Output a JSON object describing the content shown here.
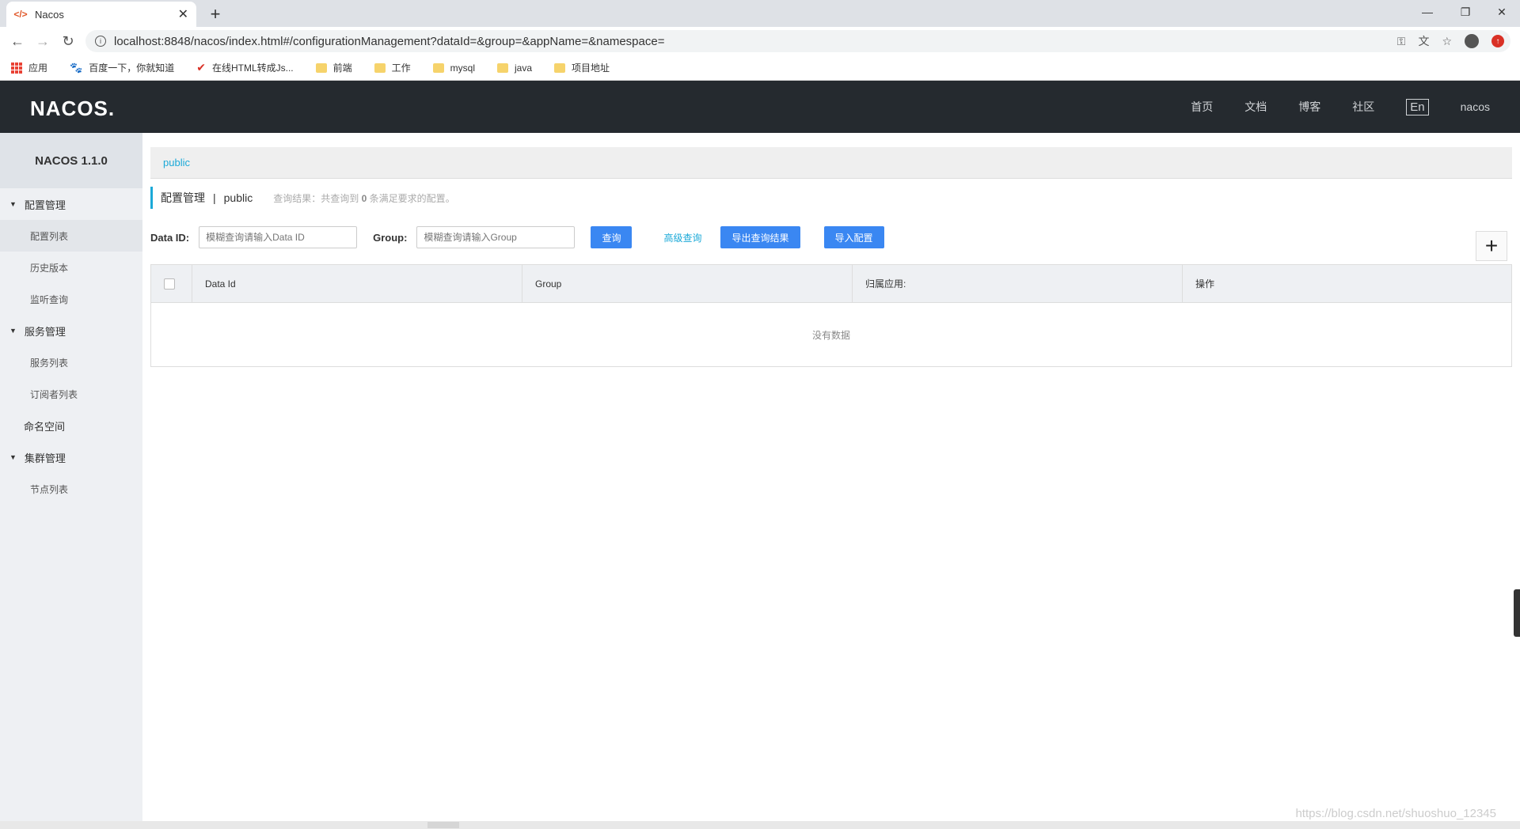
{
  "browser": {
    "tab_title": "Nacos",
    "tab_favicon": "</>",
    "url": "localhost:8848/nacos/index.html#/configurationManagement?dataId=&group=&appName=&namespace=",
    "bookmarks": [
      "应用",
      "百度一下，你就知道",
      "在线HTML转成Js...",
      "前端",
      "工作",
      "mysql",
      "java",
      "项目地址"
    ]
  },
  "header": {
    "logo": "NACOS.",
    "nav": [
      "首页",
      "文档",
      "博客",
      "社区"
    ],
    "lang": "En",
    "user": "nacos"
  },
  "sidebar": {
    "title": "NACOS 1.1.0",
    "groups": [
      {
        "label": "配置管理",
        "items": [
          "配置列表",
          "历史版本",
          "监听查询"
        ]
      },
      {
        "label": "服务管理",
        "items": [
          "服务列表",
          "订阅者列表"
        ]
      },
      {
        "label": "命名空间"
      },
      {
        "label": "集群管理",
        "items": [
          "节点列表"
        ]
      }
    ]
  },
  "main": {
    "namespace_tab": "public",
    "page_title": "配置管理",
    "page_sep": "|",
    "page_ns": "public",
    "summary_prefix": "查询结果：共查询到",
    "summary_count": "0",
    "summary_suffix": "条满足要求的配置。",
    "data_id_label": "Data ID:",
    "data_id_placeholder": "模糊查询请输入Data ID",
    "group_label": "Group:",
    "group_placeholder": "模糊查询请输入Group",
    "query_button": "查询",
    "advanced_link": "高级查询",
    "export_button": "导出查询结果",
    "import_button": "导入配置",
    "add_button": "+",
    "table": {
      "columns": [
        "Data Id",
        "Group",
        "归属应用:",
        "操作"
      ],
      "empty_text": "没有数据"
    }
  },
  "watermark": "https://blog.csdn.net/shuoshuo_12345",
  "colors": {
    "header_bg": "#252a2f",
    "accent": "#1ba9d8",
    "button_blue": "#3a87f2"
  }
}
